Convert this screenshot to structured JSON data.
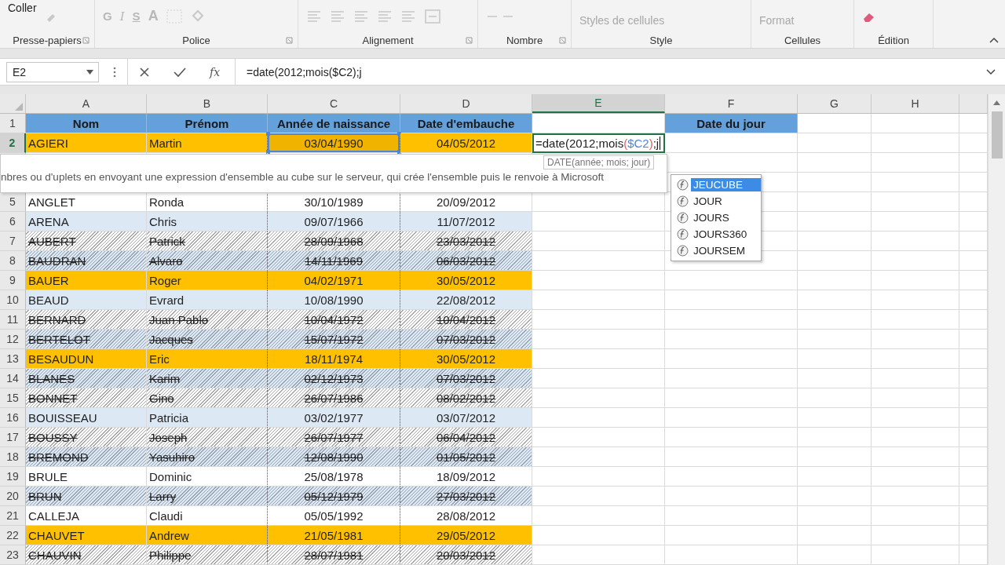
{
  "ribbon": {
    "groups": [
      {
        "kind": "clipboard",
        "label": "Presse-papiers",
        "launcher": true,
        "button": "Coller"
      },
      {
        "kind": "font",
        "label": "Police",
        "launcher": true,
        "keys": [
          "G",
          "I",
          "S",
          "A"
        ]
      },
      {
        "kind": "alignment",
        "label": "Alignement",
        "launcher": true
      },
      {
        "kind": "number",
        "label": "Nombre",
        "launcher": true
      },
      {
        "kind": "style",
        "label": "Style",
        "button": "Styles de cellules"
      },
      {
        "kind": "cells",
        "label": "Cellules",
        "button": "Format"
      },
      {
        "kind": "editing",
        "label": "Édition"
      }
    ]
  },
  "formula_bar": {
    "name_box": "E2",
    "fx": "fx",
    "formula": "=date(2012;mois($C2);j"
  },
  "sheet": {
    "columns": [
      {
        "label": "A",
        "selected": false
      },
      {
        "label": "B",
        "selected": false
      },
      {
        "label": "C",
        "selected": false
      },
      {
        "label": "D",
        "selected": false
      },
      {
        "label": "E",
        "selected": true
      },
      {
        "label": "F",
        "selected": false
      },
      {
        "label": "G",
        "selected": false
      },
      {
        "label": "H",
        "selected": false
      }
    ],
    "header_row": {
      "number": "1",
      "titles": [
        "Nom",
        "Prénom",
        "Année de naissance",
        "Date d'embauche"
      ],
      "extra_title": "Date du jour"
    },
    "rows": [
      {
        "number": "2",
        "selected": true,
        "kind": "highlight",
        "referenced": true,
        "cells": [
          "AGIERI",
          "Martin",
          "03/04/1990",
          "04/05/2012"
        ]
      },
      {
        "kind": "covered"
      },
      {
        "kind": "covered"
      },
      {
        "number": "5",
        "selected": false,
        "kind": "plain",
        "referenced": false,
        "cells": [
          "ANGLET",
          "Ronda",
          "30/10/1989",
          "20/09/2012"
        ]
      },
      {
        "number": "6",
        "selected": false,
        "kind": "plain",
        "referenced": false,
        "cells": [
          "ARENA",
          "Chris",
          "09/07/1966",
          "11/07/2012"
        ]
      },
      {
        "number": "7",
        "selected": false,
        "kind": "struck",
        "referenced": false,
        "cells": [
          "AUBERT",
          "Patrick",
          "28/09/1968",
          "23/03/2012"
        ]
      },
      {
        "number": "8",
        "selected": false,
        "kind": "struck",
        "referenced": false,
        "cells": [
          "BAUDRAN",
          "Alvaro",
          "14/11/1969",
          "06/03/2012"
        ]
      },
      {
        "number": "9",
        "selected": false,
        "kind": "highlight",
        "referenced": false,
        "cells": [
          "BAUER",
          "Roger",
          "04/02/1971",
          "30/05/2012"
        ]
      },
      {
        "number": "10",
        "selected": false,
        "kind": "plain",
        "referenced": false,
        "cells": [
          "BEAUD",
          "Evrard",
          "10/08/1990",
          "22/08/2012"
        ]
      },
      {
        "number": "11",
        "selected": false,
        "kind": "struck",
        "referenced": false,
        "cells": [
          "BERNARD",
          "Juan Pablo",
          "10/04/1972",
          "10/04/2012"
        ]
      },
      {
        "number": "12",
        "selected": false,
        "kind": "struck",
        "referenced": false,
        "cells": [
          "BERTELOT",
          "Jacques",
          "15/07/1972",
          "07/03/2012"
        ]
      },
      {
        "number": "13",
        "selected": false,
        "kind": "highlight",
        "referenced": false,
        "cells": [
          "BESAUDUN",
          "Eric",
          "18/11/1974",
          "30/05/2012"
        ]
      },
      {
        "number": "14",
        "selected": false,
        "kind": "struck",
        "referenced": false,
        "cells": [
          "BLANES",
          "Karim",
          "02/12/1973",
          "07/03/2012"
        ]
      },
      {
        "number": "15",
        "selected": false,
        "kind": "struck",
        "referenced": false,
        "cells": [
          "BONNET",
          "Gino",
          "26/07/1986",
          "08/02/2012"
        ]
      },
      {
        "number": "16",
        "selected": false,
        "kind": "plain",
        "referenced": false,
        "cells": [
          "BOUISSEAU",
          "Patricia",
          "03/02/1977",
          "03/07/2012"
        ]
      },
      {
        "number": "17",
        "selected": false,
        "kind": "struck",
        "referenced": false,
        "cells": [
          "BOUSSY",
          "Joseph",
          "26/07/1977",
          "06/04/2012"
        ]
      },
      {
        "number": "18",
        "selected": false,
        "kind": "struck",
        "referenced": false,
        "cells": [
          "BREMOND",
          "Yasuhiro",
          "12/08/1990",
          "01/05/2012"
        ]
      },
      {
        "number": "19",
        "selected": false,
        "kind": "plain",
        "referenced": false,
        "cells": [
          "BRULE",
          "Dominic",
          "25/08/1978",
          "18/09/2012"
        ]
      },
      {
        "number": "20",
        "selected": false,
        "kind": "struck",
        "referenced": false,
        "cells": [
          "BRUN",
          "Larry",
          "05/12/1979",
          "27/03/2012"
        ]
      },
      {
        "number": "21",
        "selected": false,
        "kind": "plain",
        "referenced": false,
        "cells": [
          "CALLEJA",
          "Claudi",
          "05/05/1992",
          "28/08/2012"
        ]
      },
      {
        "number": "22",
        "selected": false,
        "kind": "highlight",
        "referenced": false,
        "cells": [
          "CHAUVET",
          "Andrew",
          "21/05/1981",
          "29/05/2012"
        ]
      },
      {
        "number": "23",
        "selected": false,
        "kind": "struck",
        "referenced": false,
        "cells": [
          "CHAUVIN",
          "Philippe",
          "28/07/1981",
          "20/03/2012"
        ]
      }
    ],
    "editing_cell": {
      "parts": [
        {
          "kind": "plain",
          "text": "=date(2012;mois"
        },
        {
          "kind": "paren",
          "text": "("
        },
        {
          "kind": "ref",
          "text": "$C2"
        },
        {
          "kind": "paren",
          "text": ")"
        },
        {
          "kind": "plain",
          "text": ";j"
        }
      ]
    },
    "syntax_hint": "DATE(année; mois; jour)",
    "description_tooltip": "nbres ou d'uplets en envoyant une expression d'ensemble au cube sur le serveur, qui crée l'ensemble puis le renvoie à Microsoft",
    "autocomplete": [
      {
        "label": "JEUCUBE",
        "selected": true
      },
      {
        "label": "JOUR",
        "selected": false
      },
      {
        "label": "JOURS",
        "selected": false
      },
      {
        "label": "JOURS360",
        "selected": false
      },
      {
        "label": "JOURSEM",
        "selected": false
      }
    ]
  }
}
